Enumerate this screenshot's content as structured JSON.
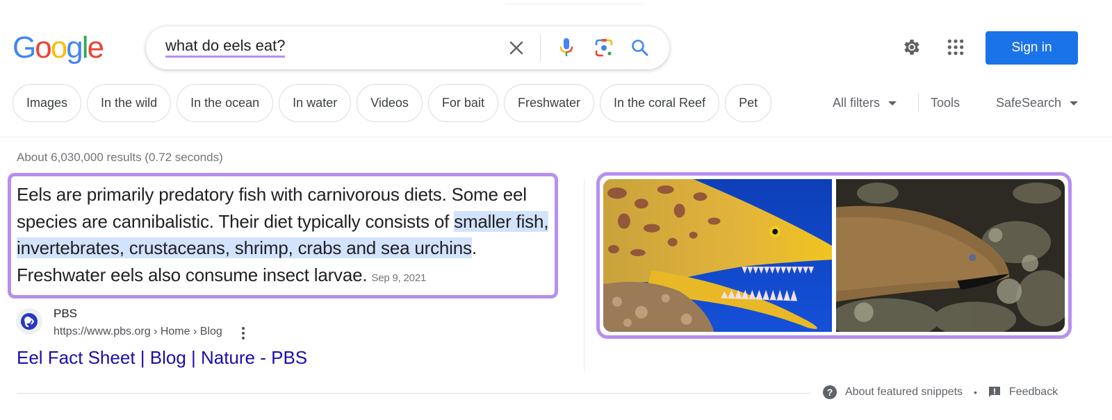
{
  "header": {
    "logo_letters": [
      {
        "char": "G",
        "color": "#4285f4"
      },
      {
        "char": "o",
        "color": "#ea4335"
      },
      {
        "char": "o",
        "color": "#fbbc05"
      },
      {
        "char": "g",
        "color": "#4285f4"
      },
      {
        "char": "l",
        "color": "#34a853"
      },
      {
        "char": "e",
        "color": "#ea4335"
      }
    ],
    "search_query": "what do eels eat?",
    "icons": {
      "clear": "close-icon",
      "voice": "microphone-icon",
      "lens": "camera-lens-icon",
      "search": "search-icon",
      "settings": "gear-icon",
      "apps": "apps-grid-icon"
    },
    "sign_in_label": "Sign in"
  },
  "filters": {
    "chips": [
      "Images",
      "In the wild",
      "In the ocean",
      "In water",
      "Videos",
      "For bait",
      "Freshwater",
      "In the coral Reef",
      "Pet"
    ],
    "all_filters_label": "All filters",
    "tools_label": "Tools",
    "safesearch_label": "SafeSearch"
  },
  "results": {
    "stats": "About 6,030,000 results (0.72 seconds)",
    "featured_snippet": {
      "text_before": "Eels are primarily predatory fish with carnivorous diets. Some eel species are cannibalistic. Their diet typically consists of ",
      "highlighted": "smaller fish, invertebrates, crustaceans, shrimp, crabs and sea urchins",
      "text_after": ". Freshwater eels also consume insect larvae.",
      "date": "Sep 9, 2021"
    },
    "source": {
      "name": "PBS",
      "url": "https://www.pbs.org › Home › Blog",
      "title": "Eel Fact Sheet | Blog | Nature - PBS"
    },
    "images": [
      {
        "alt": "Yellow moray eel with open jaws against blue water"
      },
      {
        "alt": "Brown moray eel among coral"
      }
    ]
  },
  "footer": {
    "about_label": "About featured snippets",
    "separator": "•",
    "feedback_label": "Feedback"
  },
  "colors": {
    "accent_highlight": "#b68ff0",
    "primary_blue": "#1a73e8",
    "link": "#1a0dab",
    "snippet_highlight": "#d3e3fd"
  }
}
